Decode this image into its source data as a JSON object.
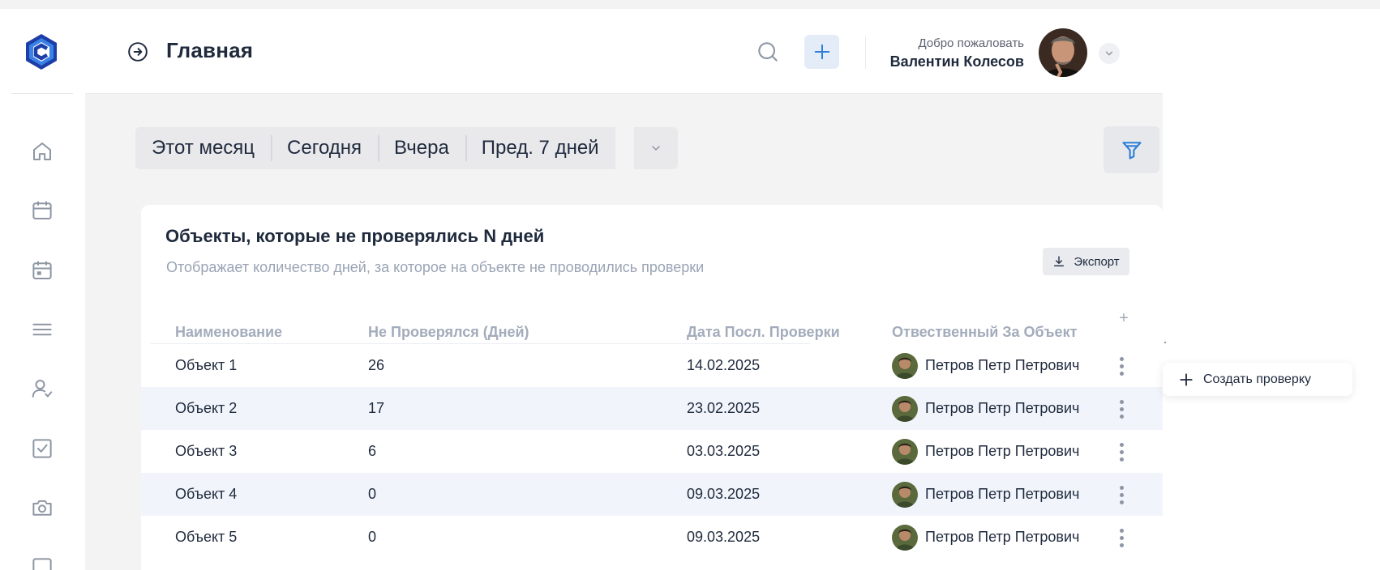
{
  "colors": {
    "accent": "#2f7fd8",
    "logo_dark": "#1d3ea8",
    "logo_light": "#4fa3f0",
    "icon_gray": "#8e96a4",
    "row_alt_bg": "#f1f5fb",
    "muted_text": "#9aa4b5"
  },
  "sidebar": {
    "logo": "app-logo-c",
    "items": [
      {
        "icon": "home-icon"
      },
      {
        "icon": "calendar-icon"
      },
      {
        "icon": "calendar-event-icon"
      },
      {
        "icon": "menu-lines-icon"
      },
      {
        "icon": "user-check-icon"
      },
      {
        "icon": "checkbox-icon"
      },
      {
        "icon": "camera-icon"
      },
      {
        "icon": "square-icon"
      }
    ]
  },
  "header": {
    "title": "Главная",
    "back_icon": "circle-arrow-right-icon",
    "search_icon": "search-icon",
    "add_icon": "plus-icon",
    "welcome_label": "Добро пожаловать",
    "user_name": "Валентин Колесов",
    "user_menu_icon": "chevron-down-icon"
  },
  "period": {
    "tabs": [
      "Этот месяц",
      "Сегодня",
      "Вчера",
      "Пред. 7 дней"
    ],
    "more_icon": "chevron-down-icon",
    "filter_icon": "funnel-icon"
  },
  "card": {
    "title": "Объекты, которые не проверялись N дней",
    "subtitle": "Отображает количество дней, за которое на объекте не проводились проверки",
    "export_label": "Экспорт",
    "columns": [
      "Наименование",
      "Не Проверялся (Дней)",
      "Дата Посл. Проверки",
      "Отвественный За Объект"
    ],
    "add_column_label": "+",
    "rows": [
      {
        "name": "Объект 1",
        "days": "26",
        "date": "14.02.2025",
        "responsible": "Петров Петр Петрович"
      },
      {
        "name": "Объект 2",
        "days": "17",
        "date": "23.02.2025",
        "responsible": "Петров Петр Петрович"
      },
      {
        "name": "Объект 3",
        "days": "6",
        "date": "03.03.2025",
        "responsible": "Петров Петр Петрович"
      },
      {
        "name": "Объект 4",
        "days": "0",
        "date": "09.03.2025",
        "responsible": "Петров Петр Петрович"
      },
      {
        "name": "Объект 5",
        "days": "0",
        "date": "09.03.2025",
        "responsible": "Петров Петр Петрович"
      }
    ]
  },
  "popup": {
    "create_label": "Создать проверку",
    "icon": "plus-icon"
  }
}
